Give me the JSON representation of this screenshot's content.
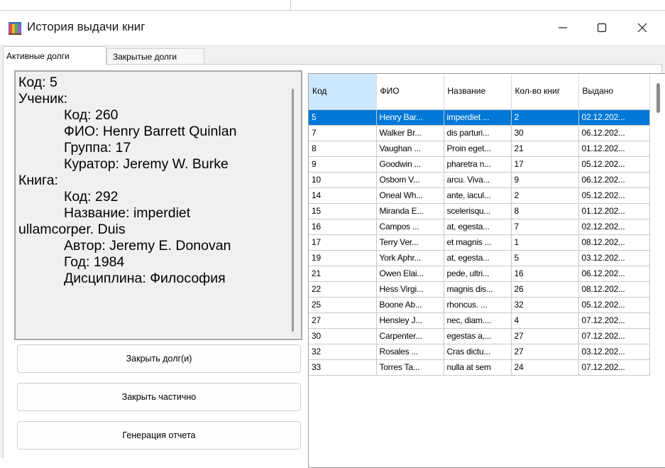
{
  "window": {
    "title": "История выдачи книг",
    "icon": "books-icon",
    "controls": {
      "minimize": "—",
      "maximize": "☐",
      "close": "✕"
    }
  },
  "tabs": [
    {
      "label": "Активные долги",
      "active": true
    },
    {
      "label": "Закрытые долги",
      "active": false
    }
  ],
  "detail": {
    "lines": [
      {
        "text": "Код: 5",
        "indent": false
      },
      {
        "text": "Ученик:",
        "indent": false
      },
      {
        "text": "Код: 260",
        "indent": true
      },
      {
        "text": "ФИО: Henry Barrett Quinlan",
        "indent": true
      },
      {
        "text": "Группа: 17",
        "indent": true
      },
      {
        "text": "Куратор: Jeremy W. Burke",
        "indent": true
      },
      {
        "text": "Книга:",
        "indent": false
      },
      {
        "text": "Код: 292",
        "indent": true
      },
      {
        "text": "Название: imperdiet",
        "indent": true
      },
      {
        "text": "ullamcorper. Duis",
        "indent": false
      },
      {
        "text": "Автор: Jeremy E. Donovan",
        "indent": true
      },
      {
        "text": "Год: 1984",
        "indent": true
      },
      {
        "text": "Дисциплина: Философия",
        "indent": true
      }
    ]
  },
  "buttons": {
    "close_debt": "Закрыть долг(и)",
    "close_partial": "Закрыть частично",
    "report": "Генерация отчета"
  },
  "table": {
    "columns": [
      "Код",
      "ФИО",
      "Название",
      "Кол-во книг",
      "Выдано"
    ],
    "selected_row": 0,
    "rows": [
      [
        "5",
        "Henry Bar...",
        "imperdiet ...",
        "2",
        "02.12.202..."
      ],
      [
        "7",
        "Walker Br...",
        "dis parturi...",
        "30",
        "06.12.202..."
      ],
      [
        "8",
        "Vaughan ...",
        "Proin eget...",
        "21",
        "01.12.202..."
      ],
      [
        "9",
        "Goodwin ...",
        "pharetra n...",
        "17",
        "05.12.202..."
      ],
      [
        "10",
        "Osbom V...",
        "arcu. Viva...",
        "9",
        "06.12.202..."
      ],
      [
        "14",
        "Oneal Wh...",
        "ante, iacul...",
        "2",
        "05.12.202..."
      ],
      [
        "15",
        "Miranda E...",
        "scelerisqu...",
        "8",
        "01.12.202..."
      ],
      [
        "16",
        "Campos ...",
        "at, egesta...",
        "7",
        "02.12.202..."
      ],
      [
        "17",
        "Terry Ver...",
        "et magnis ...",
        "1",
        "08.12.202..."
      ],
      [
        "19",
        "York Aphr...",
        "at, egesta...",
        "5",
        "03.12.202..."
      ],
      [
        "21",
        "Owen Elai...",
        "pede, ultri...",
        "16",
        "06.12.202..."
      ],
      [
        "22",
        "Hess Virgi...",
        "magnis dis...",
        "26",
        "08.12.202..."
      ],
      [
        "25",
        "Boone Ab...",
        "rhoncus. ...",
        "32",
        "05.12.202..."
      ],
      [
        "27",
        "Hensley J...",
        "nec, diam....",
        "4",
        "07.12.202..."
      ],
      [
        "30",
        "Carpenter...",
        "egestas a,...",
        "27",
        "07.12.202..."
      ],
      [
        "32",
        "Rosales ...",
        "Cras dictu...",
        "27",
        "03.12.202..."
      ],
      [
        "33",
        "Torres Ta...",
        "nulla at sem",
        "24",
        "07.12.202..."
      ]
    ]
  }
}
